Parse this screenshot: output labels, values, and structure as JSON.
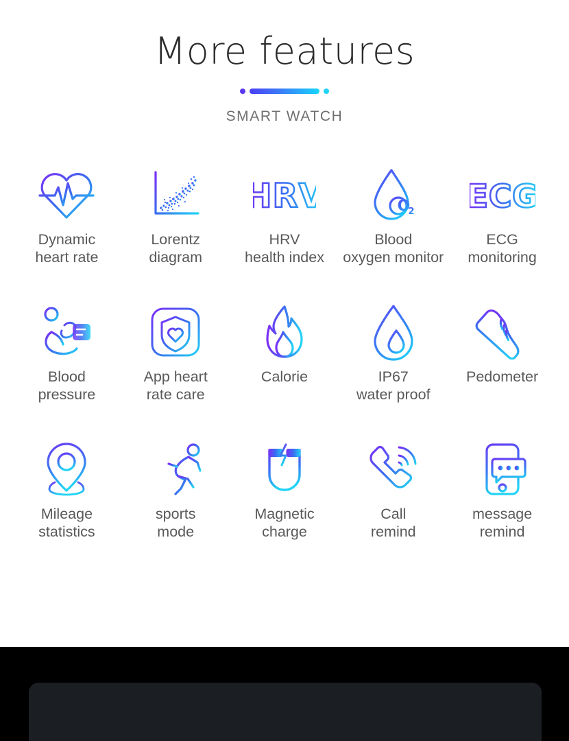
{
  "header": {
    "title": "More features",
    "subtitle": "SMART WATCH",
    "divider": {
      "dot_left_color": "#5b39f3",
      "bar_gradient_from": "#4a3ff5",
      "bar_gradient_to": "#18d5fb",
      "dot_right_color": "#21d3fb"
    }
  },
  "theme": {
    "background": "#ffffff",
    "title_color": "#2b2b2b",
    "subtitle_color": "#6f6f6f",
    "label_color": "#595959",
    "gradient_start": "#7b2ff7",
    "gradient_mid": "#3a6df0",
    "gradient_end": "#22d3f5",
    "bottom_band_color": "#000000",
    "bottom_panel_color": "#1b1e23"
  },
  "features": [
    {
      "icon": "dynamic-heart-rate-icon",
      "label": "Dynamic\nheart rate"
    },
    {
      "icon": "lorentz-diagram-icon",
      "label": "Lorentz\ndiagram"
    },
    {
      "icon": "hrv-icon",
      "label": "HRV\nhealth index"
    },
    {
      "icon": "blood-oxygen-drop-icon",
      "label": "Blood\noxygen monitor"
    },
    {
      "icon": "ecg-icon",
      "label": "ECG\nmonitoring"
    },
    {
      "icon": "blood-pressure-monitor-icon",
      "label": "Blood\npressure"
    },
    {
      "icon": "app-shield-heart-icon",
      "label": "App heart\nrate care"
    },
    {
      "icon": "flame-icon",
      "label": "Calorie"
    },
    {
      "icon": "water-drop-icon",
      "label": "IP67\nwater proof"
    },
    {
      "icon": "sneaker-icon",
      "label": "Pedometer"
    },
    {
      "icon": "map-pin-icon",
      "label": "Mileage\nstatistics"
    },
    {
      "icon": "running-person-icon",
      "label": "sports\nmode"
    },
    {
      "icon": "magnet-charge-icon",
      "label": "Magnetic\ncharge"
    },
    {
      "icon": "phone-call-icon",
      "label": "Call\nremind"
    },
    {
      "icon": "phone-message-icon",
      "label": "message\nremind"
    }
  ],
  "icon_text": {
    "hrv": "HRV",
    "ecg": "ECG",
    "blood_oxygen": "O",
    "blood_oxygen_sub": "2"
  }
}
